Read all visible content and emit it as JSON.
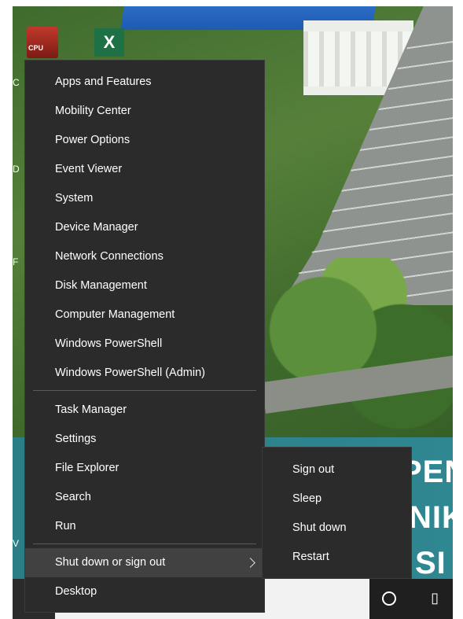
{
  "context_menu": {
    "groups": [
      [
        "Apps and Features",
        "Mobility Center",
        "Power Options",
        "Event Viewer",
        "System",
        "Device Manager",
        "Network Connections",
        "Disk Management",
        "Computer Management",
        "Windows PowerShell",
        "Windows PowerShell (Admin)"
      ],
      [
        "Task Manager",
        "Settings",
        "File Explorer",
        "Search",
        "Run"
      ],
      [
        "Shut down or sign out",
        "Desktop"
      ]
    ],
    "highlighted_item": "Shut down or sign out"
  },
  "submenu": {
    "items": [
      "Sign out",
      "Sleep",
      "Shut down",
      "Restart"
    ]
  },
  "desktop": {
    "banner_text": [
      "PEN",
      "NIK",
      "SI D"
    ],
    "icons": [
      "cpu-z-icon",
      "excel-icon"
    ],
    "side_letters": [
      "C",
      "D",
      "F",
      "V"
    ]
  },
  "taskbar": {
    "icons": [
      "cortana-circle-icon",
      "task-view-icon"
    ]
  },
  "colors": {
    "menu_bg": "#2b2b2b",
    "menu_highlight": "#414141",
    "menu_text": "#ffffff",
    "banner": "#2f8791"
  }
}
